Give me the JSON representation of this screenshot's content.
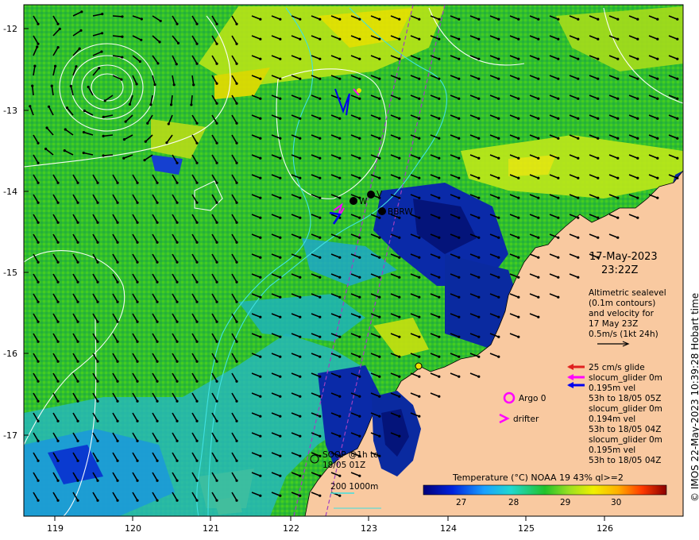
{
  "map": {
    "lat_ticks": [
      "-12",
      "-13",
      "-14",
      "-15",
      "-16",
      "-17"
    ],
    "lon_ticks": [
      "119",
      "120",
      "121",
      "122",
      "123",
      "124",
      "125",
      "126"
    ],
    "lat_range": [
      -18,
      -11.9
    ],
    "lon_range": [
      118.6,
      127
    ]
  },
  "datetime": {
    "date": "17-May-2023",
    "time": "23:22Z"
  },
  "altimetry_note": {
    "line1": "Altimetric sealevel",
    "line2": "(0.1m contours)",
    "line3": "and velocity for",
    "line4": "17 May 23Z",
    "line5": "0.5m/s (1kt 24h)"
  },
  "legend": {
    "glide": "25 cm/s glide",
    "glider1_a": "slocum_glider 0m",
    "glider1_b": "0.195m vel",
    "glider1_c": "53h to 18/05 05Z",
    "glider2_a": "slocum_glider 0m",
    "glider2_b": "0.194m vel",
    "glider2_c": "53h to 18/05 04Z",
    "glider3_a": "slocum_glider 0m",
    "glider3_b": "0.195m vel",
    "glider3_c": "53h to 18/05 04Z",
    "argo": "Argo 0",
    "drifter": "drifter",
    "soop_a": "SOOP @1h to",
    "soop_b": "18/05 01Z",
    "depth_contours": "200  1000m"
  },
  "station_labels": {
    "w": "W",
    "v": "V",
    "bbrw": "BBRW"
  },
  "colorbar": {
    "title": "Temperature (°C) NOAA 19 43% ql>=2",
    "ticks": [
      "27",
      "28",
      "29",
      "30"
    ],
    "min": 26.3,
    "max": 31
  },
  "copyright": "© IMOS 22-May-2023 10:39:28 Hobart time",
  "colors": {
    "land": "#f9c9a0",
    "glide_arrow": "#e02020",
    "glider_magenta": "#ff00ff",
    "glider_blue": "#0000ee",
    "contour": "#ffffff",
    "bathy": "#40e0e0"
  }
}
